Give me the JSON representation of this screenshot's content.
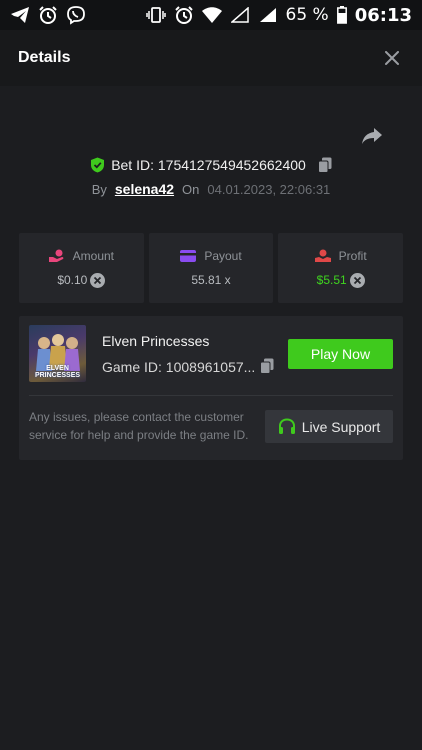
{
  "statusbar": {
    "battery": "65 %",
    "time": "06:13"
  },
  "header": {
    "title": "Details"
  },
  "bet": {
    "id_label": "Bet ID: 1754127549452662400",
    "by_label": "By",
    "username": "selena42",
    "on_label": "On",
    "date": "04.01.2023, 22:06:31"
  },
  "stats": [
    {
      "label": "Amount",
      "value": "$0.10",
      "icon": "hand-coins-icon",
      "color": "#e8467c"
    },
    {
      "label": "Payout",
      "value": "55.81 x",
      "icon": "card-icon",
      "color": "#8a4cf0"
    },
    {
      "label": "Profit",
      "value": "$5.51",
      "icon": "coin-hand-icon",
      "color": "#e04848"
    }
  ],
  "game": {
    "name": "Elven Princesses",
    "id_label": "Game ID: 1008961057...",
    "thumb_title_1": "ELVEN",
    "thumb_title_2": "PRINCESSES",
    "play_label": "Play Now",
    "issue_text": "Any issues, please contact the customer service for help and provide the game ID.",
    "support_label": "Live Support"
  },
  "colors": {
    "accent_green": "#3fca1d",
    "background": "#1c1d20",
    "card": "#25262a"
  }
}
